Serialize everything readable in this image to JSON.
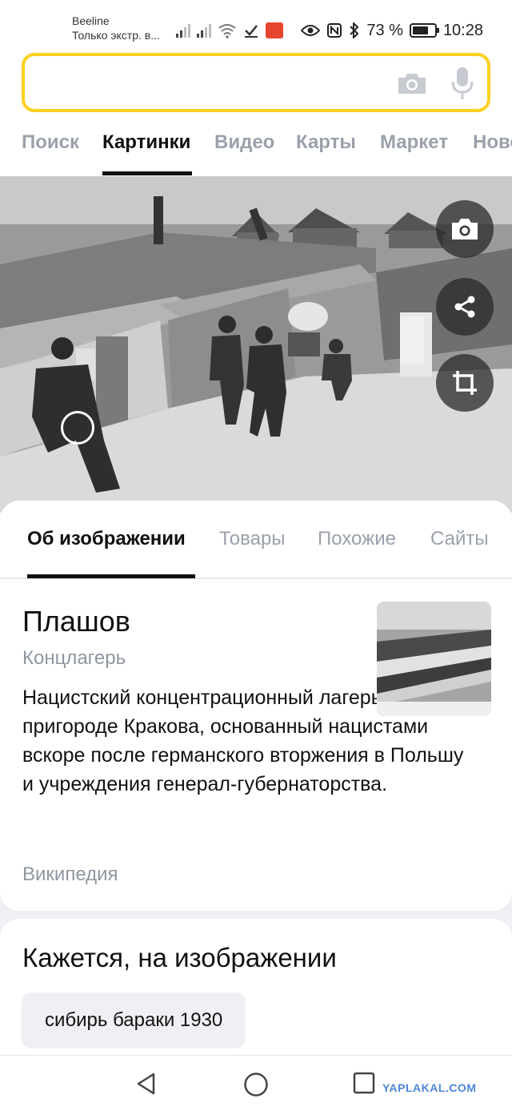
{
  "status_bar": {
    "carrier": "Beeline",
    "carrier_sub": "Только экстр. в...",
    "battery_percent": "73 %",
    "battery_level": 0.73,
    "time": "10:28"
  },
  "search": {
    "value": "",
    "placeholder": ""
  },
  "nav_tabs": [
    {
      "label": "Поиск",
      "active": false
    },
    {
      "label": "Картинки",
      "active": true
    },
    {
      "label": "Видео",
      "active": false
    },
    {
      "label": "Карты",
      "active": false
    },
    {
      "label": "Маркет",
      "active": false
    },
    {
      "label": "Ново",
      "active": false
    }
  ],
  "image_actions": [
    "camera-icon",
    "share-icon",
    "crop-icon"
  ],
  "sub_tabs": [
    {
      "label": "Об изображении",
      "active": true
    },
    {
      "label": "Товары",
      "active": false
    },
    {
      "label": "Похожие",
      "active": false
    },
    {
      "label": "Сайты",
      "active": false
    }
  ],
  "info": {
    "title": "Плашов",
    "subtitle": "Концлагерь",
    "description": "Нацистский концентрационный лагерь в южном пригороде Кракова, основанный нацистами вскоре после германского вторжения в Польшу и учреждения генерал-губернаторства.",
    "source": "Википедия"
  },
  "recognized": {
    "title": "Кажется, на изображении",
    "chip": "сибирь бараки 1930"
  },
  "bottom_nav": [
    "back-icon",
    "home-icon",
    "recents-icon"
  ],
  "watermark": "YAPLAKAL.COM",
  "colors": {
    "accent_yellow": "#fdd01f",
    "muted_text": "#8f96a1",
    "sheet_bg": "#eef0f3"
  }
}
